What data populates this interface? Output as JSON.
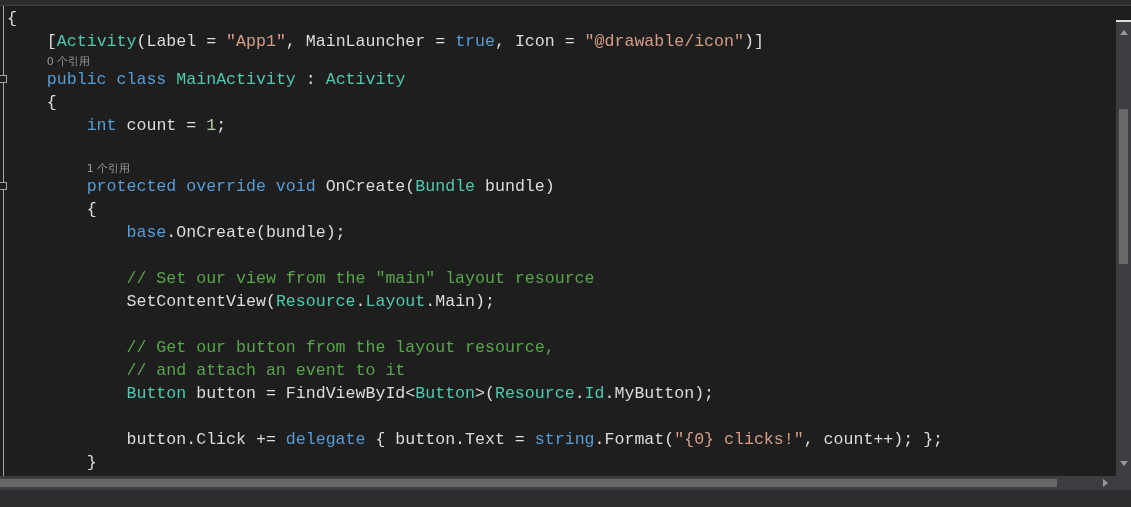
{
  "editor": {
    "lines": [
      {
        "kind": "code",
        "fold": false,
        "tokens": [
          {
            "kind": "plain",
            "t": "{"
          }
        ]
      },
      {
        "kind": "code",
        "fold": false,
        "tokens": [
          {
            "kind": "plain",
            "t": "    ["
          },
          {
            "kind": "type",
            "t": "Activity"
          },
          {
            "kind": "plain",
            "t": "(Label = "
          },
          {
            "kind": "string",
            "t": "\"App1\""
          },
          {
            "kind": "plain",
            "t": ", MainLauncher = "
          },
          {
            "kind": "keyword",
            "t": "true"
          },
          {
            "kind": "plain",
            "t": ", Icon = "
          },
          {
            "kind": "string",
            "t": "\"@drawable/icon\""
          },
          {
            "kind": "plain",
            "t": ")]"
          }
        ]
      },
      {
        "kind": "ref",
        "fold": false,
        "tokens": [
          {
            "kind": "ref",
            "t": "    0 个引用"
          }
        ]
      },
      {
        "kind": "code",
        "fold": true,
        "tokens": [
          {
            "kind": "keyword",
            "t": "    public class "
          },
          {
            "kind": "type",
            "t": "MainActivity"
          },
          {
            "kind": "plain",
            "t": " : "
          },
          {
            "kind": "type",
            "t": "Activity"
          }
        ]
      },
      {
        "kind": "code",
        "fold": false,
        "tokens": [
          {
            "kind": "plain",
            "t": "    {"
          }
        ]
      },
      {
        "kind": "code",
        "fold": false,
        "tokens": [
          {
            "kind": "keyword",
            "t": "        int"
          },
          {
            "kind": "plain",
            "t": " count = "
          },
          {
            "kind": "number",
            "t": "1"
          },
          {
            "kind": "plain",
            "t": ";"
          }
        ]
      },
      {
        "kind": "blank",
        "fold": false
      },
      {
        "kind": "ref",
        "fold": false,
        "tokens": [
          {
            "kind": "ref",
            "t": "        1 个引用"
          }
        ]
      },
      {
        "kind": "code",
        "fold": true,
        "tokens": [
          {
            "kind": "keyword",
            "t": "        protected override void"
          },
          {
            "kind": "plain",
            "t": " OnCreate("
          },
          {
            "kind": "type",
            "t": "Bundle"
          },
          {
            "kind": "plain",
            "t": " bundle)"
          }
        ]
      },
      {
        "kind": "code",
        "fold": false,
        "tokens": [
          {
            "kind": "plain",
            "t": "        {"
          }
        ]
      },
      {
        "kind": "code",
        "fold": false,
        "tokens": [
          {
            "kind": "keyword",
            "t": "            base"
          },
          {
            "kind": "plain",
            "t": ".OnCreate(bundle);"
          }
        ]
      },
      {
        "kind": "blank",
        "fold": false
      },
      {
        "kind": "code",
        "fold": false,
        "tokens": [
          {
            "kind": "comment",
            "t": "            // Set our view from the \"main\" layout resource"
          }
        ]
      },
      {
        "kind": "code",
        "fold": false,
        "tokens": [
          {
            "kind": "plain",
            "t": "            SetContentView("
          },
          {
            "kind": "type",
            "t": "Resource"
          },
          {
            "kind": "plain",
            "t": "."
          },
          {
            "kind": "type",
            "t": "Layout"
          },
          {
            "kind": "plain",
            "t": ".Main);"
          }
        ]
      },
      {
        "kind": "blank",
        "fold": false
      },
      {
        "kind": "code",
        "fold": false,
        "tokens": [
          {
            "kind": "comment",
            "t": "            // Get our button from the layout resource,"
          }
        ]
      },
      {
        "kind": "code",
        "fold": false,
        "tokens": [
          {
            "kind": "comment",
            "t": "            // and attach an event to it"
          }
        ]
      },
      {
        "kind": "code",
        "fold": false,
        "tokens": [
          {
            "kind": "type",
            "t": "            Button"
          },
          {
            "kind": "plain",
            "t": " button = FindViewById<"
          },
          {
            "kind": "type",
            "t": "Button"
          },
          {
            "kind": "plain",
            "t": ">("
          },
          {
            "kind": "type",
            "t": "Resource"
          },
          {
            "kind": "plain",
            "t": "."
          },
          {
            "kind": "type",
            "t": "Id"
          },
          {
            "kind": "plain",
            "t": ".MyButton);"
          }
        ]
      },
      {
        "kind": "blank",
        "fold": false
      },
      {
        "kind": "code",
        "fold": false,
        "tokens": [
          {
            "kind": "plain",
            "t": "            button.Click += "
          },
          {
            "kind": "keyword",
            "t": "delegate"
          },
          {
            "kind": "plain",
            "t": " { button.Text = "
          },
          {
            "kind": "keyword",
            "t": "string"
          },
          {
            "kind": "plain",
            "t": ".Format("
          },
          {
            "kind": "string",
            "t": "\"{0} clicks!\""
          },
          {
            "kind": "plain",
            "t": ", count++); };"
          }
        ]
      },
      {
        "kind": "code",
        "fold": false,
        "tokens": [
          {
            "kind": "plain",
            "t": "        }"
          }
        ]
      }
    ]
  }
}
